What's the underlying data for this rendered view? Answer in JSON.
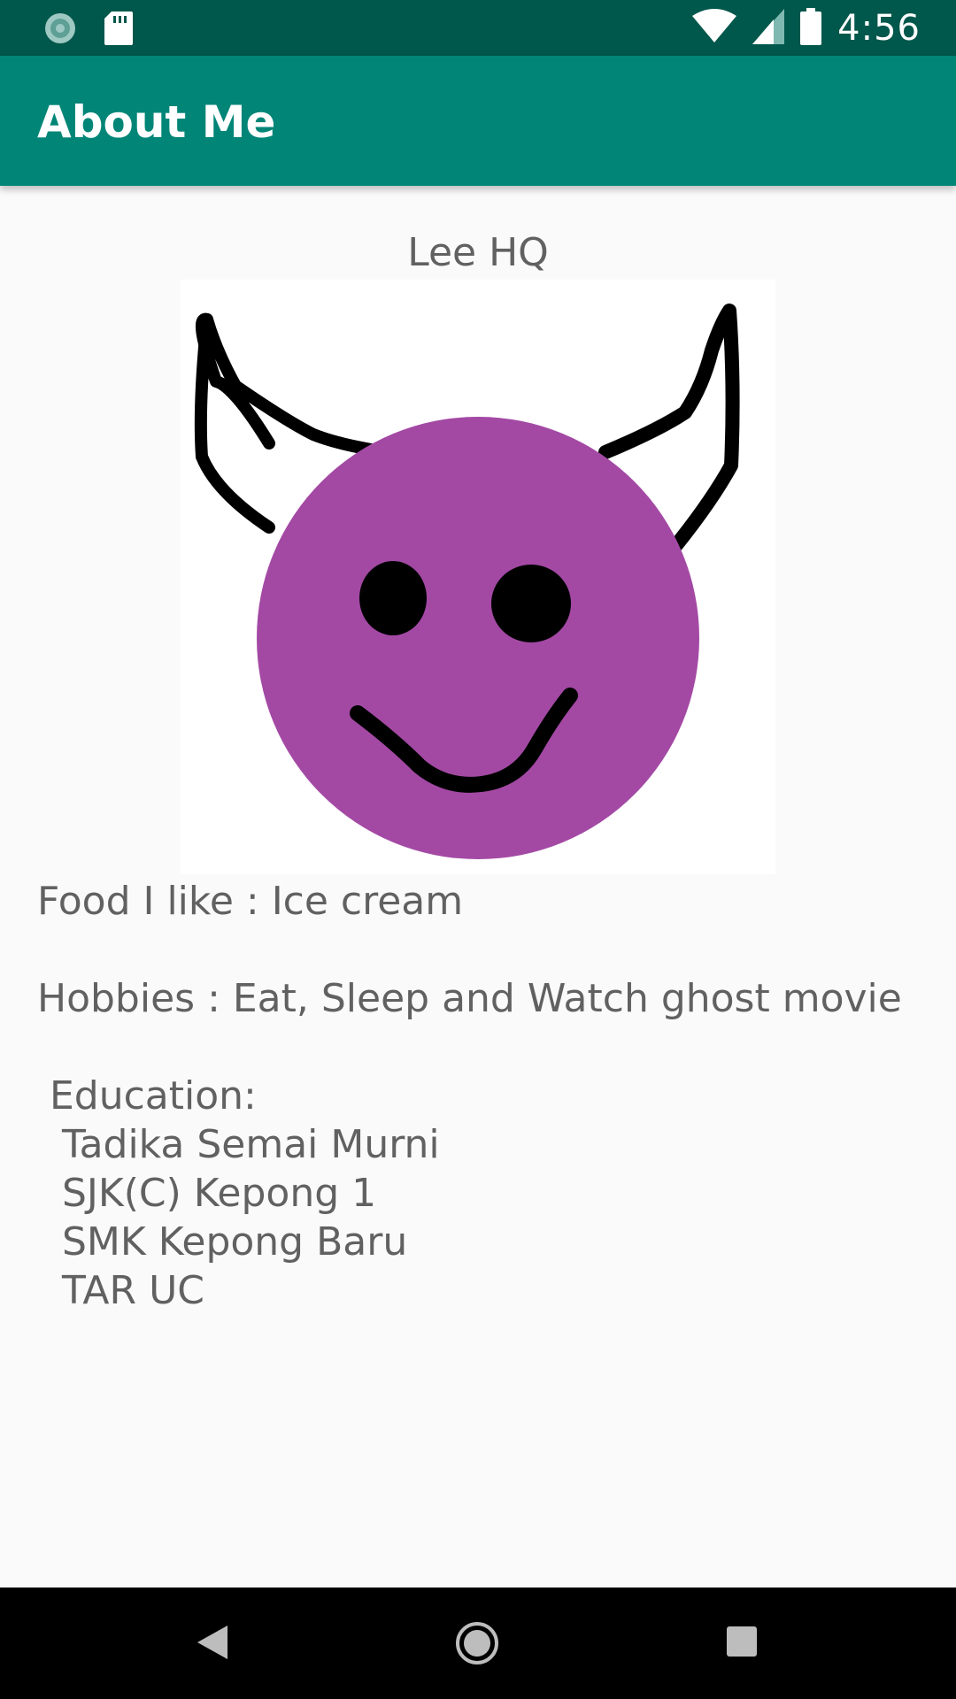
{
  "status_bar": {
    "time": "4:56",
    "icons": [
      "sync-icon",
      "sd-card-icon",
      "wifi-icon",
      "signal-icon",
      "battery-icon"
    ]
  },
  "app_bar": {
    "title": "About Me"
  },
  "profile": {
    "name": "Lee HQ",
    "avatar": "purple-devil-smiley-drawing",
    "food": "Food I like : Ice cream",
    "hobbies": "Hobbies : Eat, Sleep and Watch ghost movie",
    "education_heading": " Education:",
    "education": [
      "  Tadika Semai Murni",
      "  SJK(C) Kepong 1",
      "  SMK Kepong Baru",
      "  TAR UC"
    ]
  },
  "nav_bar": {
    "icons": [
      "back-icon",
      "home-icon",
      "recents-icon"
    ]
  },
  "colors": {
    "status_bar": "#00574b",
    "app_bar": "#008577",
    "avatar_face": "#a349a4",
    "text": "#616161"
  }
}
